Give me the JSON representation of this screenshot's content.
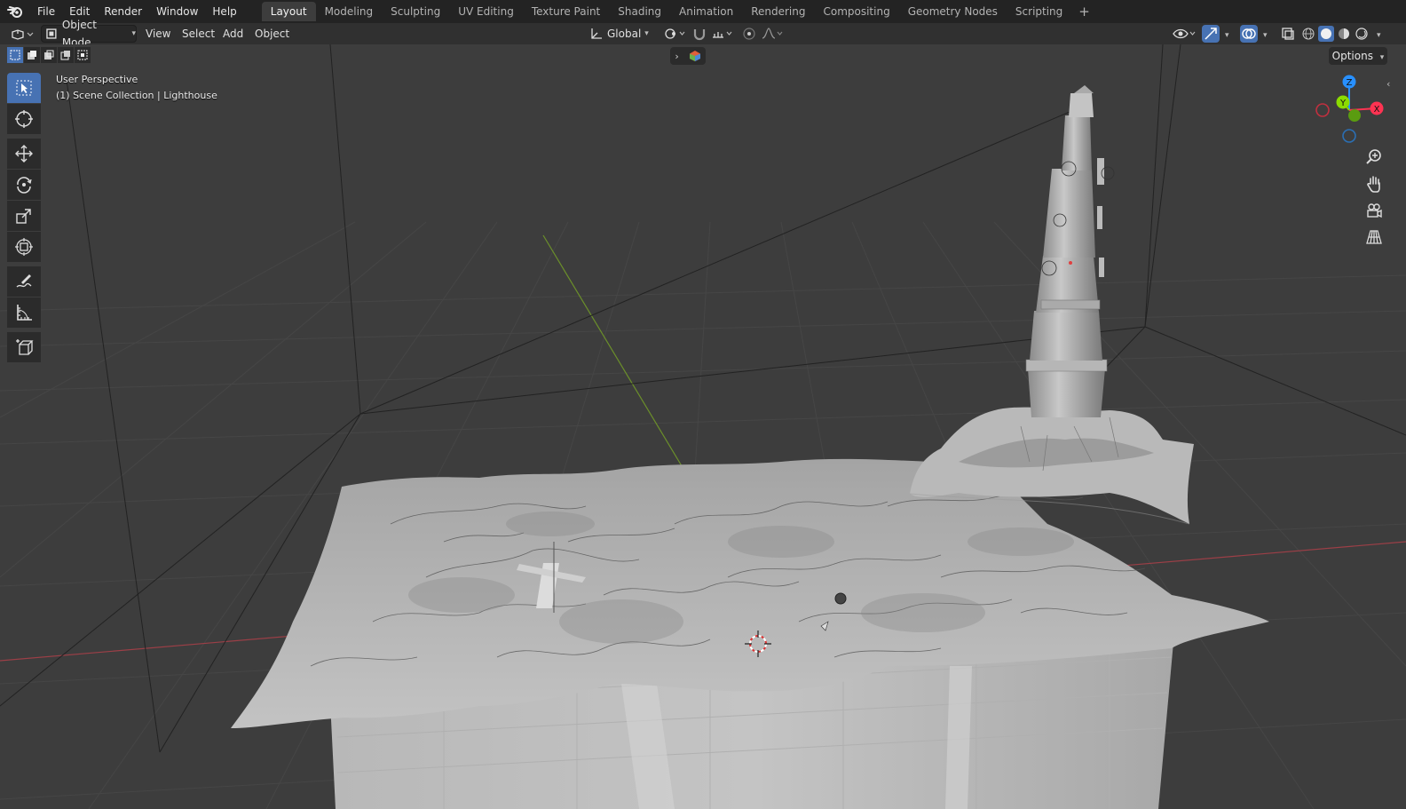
{
  "menus": [
    "File",
    "Edit",
    "Render",
    "Window",
    "Help"
  ],
  "workspaces": [
    {
      "label": "Layout",
      "active": true
    },
    {
      "label": "Modeling",
      "active": false
    },
    {
      "label": "Sculpting",
      "active": false
    },
    {
      "label": "UV Editing",
      "active": false
    },
    {
      "label": "Texture Paint",
      "active": false
    },
    {
      "label": "Shading",
      "active": false
    },
    {
      "label": "Animation",
      "active": false
    },
    {
      "label": "Rendering",
      "active": false
    },
    {
      "label": "Compositing",
      "active": false
    },
    {
      "label": "Geometry Nodes",
      "active": false
    },
    {
      "label": "Scripting",
      "active": false
    }
  ],
  "workspace_add": "+",
  "header": {
    "mode": "Object Mode",
    "view": "View",
    "select": "Select",
    "add": "Add",
    "object": "Object",
    "orientation": "Global",
    "options": "Options"
  },
  "viewport": {
    "perspective": "User Perspective",
    "collection": "(1) Scene Collection | Lighthouse"
  },
  "gizmo": {
    "z": "Z",
    "y": "Y",
    "x": "X"
  },
  "colors": {
    "accent": "#4772b3",
    "x_axis": "#ff3352",
    "y_axis": "#8bdc00",
    "z_axis": "#2890ff"
  }
}
